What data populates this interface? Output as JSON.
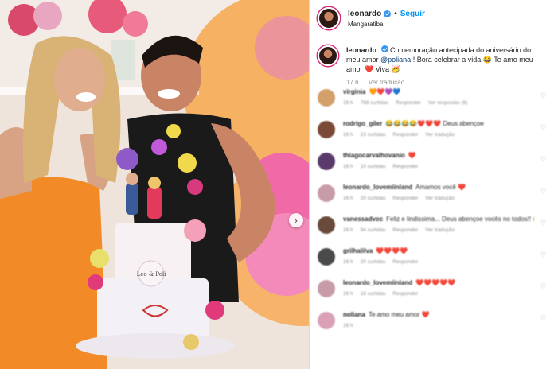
{
  "post": {
    "username": "leonardo",
    "follow_label": "Seguir",
    "separator": "•",
    "location": "Mangaratiba",
    "caption_user": "leonardo",
    "caption_text_1": "Comemoração antecipada do aniversário do meu amor ",
    "caption_mention": "@poliana",
    "caption_text_2": " ! Bora celebrar a vida 😂 Te amo meu amor ❤️ Viva 🥳",
    "time": "17 h",
    "translate_label": "Ver tradução"
  },
  "photo": {
    "cake_topper_text": "Leo & Poli"
  },
  "comments": [
    {
      "user": "virginia",
      "text": "🧡❤️💜💙",
      "time": "16 h",
      "likes": "788 curtidas",
      "reply": "Responder",
      "extra": "Ver respostas (6)",
      "avatar_color": "#d4a06a"
    },
    {
      "user": "rodrigo_giler",
      "text": "😂😂😂😂❤️❤️❤️ Deus abençoe",
      "time": "16 h",
      "likes": "23 curtidas",
      "reply": "Responder",
      "extra": "Ver tradução",
      "avatar_color": "#7a4a36"
    },
    {
      "user": "thiagocarvalhovanio",
      "text": "❤️",
      "time": "16 h",
      "likes": "10 curtidas",
      "reply": "Responder",
      "extra": "",
      "avatar_color": "#5a3a6a"
    },
    {
      "user": "leonardo_lovemiinland",
      "text": "Amamos você ❤️",
      "time": "16 h",
      "likes": "20 curtidas",
      "reply": "Responder",
      "extra": "Ver tradução",
      "avatar_color": "#c89ba8"
    },
    {
      "user": "vanessadvoc",
      "text": "Feliz e lindissima... Deus abençoe vocês no todos!! 😂😂😂😂🎉",
      "time": "16 h",
      "likes": "94 curtidas",
      "reply": "Responder",
      "extra": "Ver tradução",
      "avatar_color": "#6a4a3a"
    },
    {
      "user": "grilhalilva",
      "text": "❤️❤️❤️❤️",
      "time": "16 h",
      "likes": "20 curtidas",
      "reply": "Responder",
      "extra": "",
      "avatar_color": "#4a4a4a"
    },
    {
      "user": "leonardo_lovemiinland",
      "text": "❤️❤️❤️❤️❤️",
      "time": "16 h",
      "likes": "18 curtidas",
      "reply": "Responder",
      "extra": "",
      "avatar_color": "#c89ba8"
    },
    {
      "user": "noliana",
      "text": "Te amo meu amor ❤️",
      "time": "16 h",
      "likes": "",
      "reply": "",
      "extra": "",
      "avatar_color": "#d9a0b8"
    }
  ],
  "icons": {
    "next": "chevron-right-icon",
    "verified": "verified-badge-icon",
    "like": "heart-outline-icon"
  },
  "colors": {
    "accent": "#0095f6",
    "verified": "#3897f0",
    "heart": "#e0245e",
    "mention": "#00376b"
  }
}
